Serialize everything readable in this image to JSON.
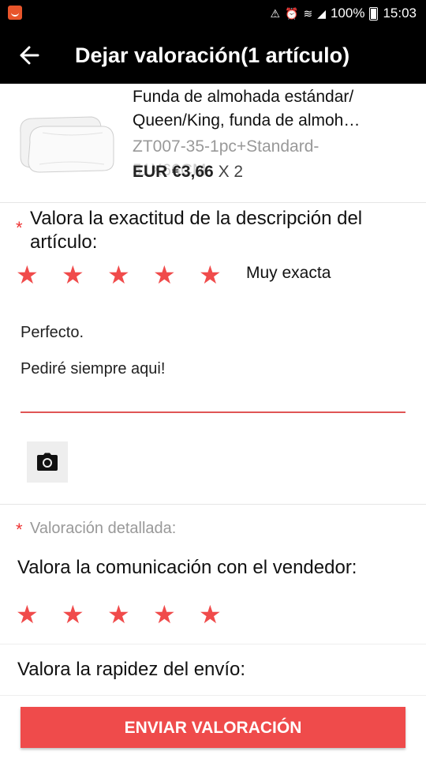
{
  "status_bar": {
    "battery": "100%",
    "time": "15:03"
  },
  "header": {
    "title": "Dejar valoración(1 artículo)"
  },
  "product": {
    "name": "Funda de almohada estándar/ Queen/King, funda de almoh…",
    "sku": "ZT007-35-1pc+Standard-",
    "sku_partial": "51X66CM",
    "price": "EUR €3,66",
    "quantity": " X 2"
  },
  "accuracy": {
    "label": "Valora la exactitud de la descripción del artículo:",
    "rating_text": "Muy exacta",
    "stars": 5
  },
  "review": {
    "line1": "Perfecto.",
    "line2": "Pediré siempre aqui!"
  },
  "detailed": {
    "label": "Valoración detallada:",
    "communication_label": "Valora la comunicación con el vendedor:",
    "communication_stars": 5,
    "shipping_label": "Valora la rapidez del envío:"
  },
  "footer": {
    "submit_label": "ENVIAR VALORACIÓN"
  },
  "colors": {
    "accent": "#ef4b4b",
    "star": "#f04b4b",
    "appbar": "#000000"
  },
  "required_mark": "*"
}
